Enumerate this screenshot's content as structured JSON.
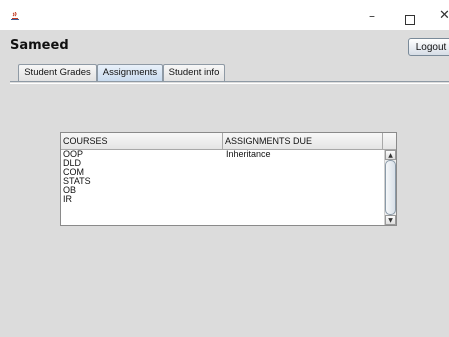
{
  "window": {
    "icon": "java-coffee-icon",
    "controls": {
      "minimize": "–",
      "maximize": "☐",
      "close": "✕"
    }
  },
  "header": {
    "user_name": "Sameed",
    "logout_label": "Logout"
  },
  "tabs": [
    {
      "label": "Student Grades",
      "active": false
    },
    {
      "label": "Assignments",
      "active": true
    },
    {
      "label": "Student info",
      "active": false
    }
  ],
  "table": {
    "columns": [
      "COURSES",
      "ASSIGNMENTS DUE"
    ],
    "rows": [
      {
        "course": "OOP",
        "assignment": "Inheritance"
      },
      {
        "course": "DLD",
        "assignment": ""
      },
      {
        "course": "COM",
        "assignment": ""
      },
      {
        "course": "STATS",
        "assignment": ""
      },
      {
        "course": "OB",
        "assignment": ""
      },
      {
        "course": "IR",
        "assignment": ""
      }
    ],
    "scroll_up_icon": "▲",
    "scroll_down_icon": "▼"
  },
  "colors": {
    "window_bg": "#dcdcdc",
    "desktop_bg": "#cddff0",
    "active_tab": "#c9dbef"
  }
}
